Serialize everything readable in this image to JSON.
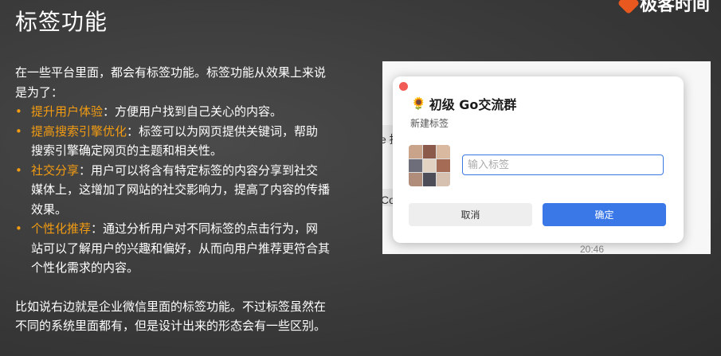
{
  "slide": {
    "title": "标签功能",
    "logo_text": "极客时间",
    "intro": "在一些平台里面，都会有标签功能。标签功能从效果上来说是为了：",
    "bullets": [
      {
        "dot": "•",
        "term": "提升用户体验",
        "text": "：方便用户找到自己关心的内容。"
      },
      {
        "dot": "•",
        "term": "提高搜索引擎优化",
        "text": "：标签可以为网页提供关键词，帮助搜索引擎确定网页的主题和相关性。"
      },
      {
        "dot": "•",
        "term": "社交分享",
        "text": "：用户可以将含有特定标签的内容分享到社交媒体上，这增加了网站的社交影响力，提高了内容的传播效果。"
      },
      {
        "dot": "•",
        "term": "个性化推荐",
        "text": "：通过分析用户对不同标签的点击行为，网站可以了解用户的兴趣和偏好，从而向用户推荐更符合其个性化需求的内容。"
      }
    ],
    "outro": "比如说右边就是企业微信里面的标签功能。不过标签虽然在不同的系统里面都有，但是设计出来的形态会有一些区别。"
  },
  "screenshot": {
    "bg_fragments": [
      "e 执",
      "Co",
      "20:46"
    ],
    "dialog": {
      "flower_icon": "🌻",
      "group_name": "初级 Go交流群",
      "subtitle": "新建标签",
      "input_placeholder": "输入标签",
      "cancel_label": "取消",
      "confirm_label": "确定"
    },
    "avatar_colors": [
      "#c9a48a",
      "#8b5a4a",
      "#d9b9a0",
      "#6e6e7a",
      "#e2d2c2",
      "#a56b55",
      "#b08d7a",
      "#4d4d58",
      "#d6c0b0"
    ]
  }
}
